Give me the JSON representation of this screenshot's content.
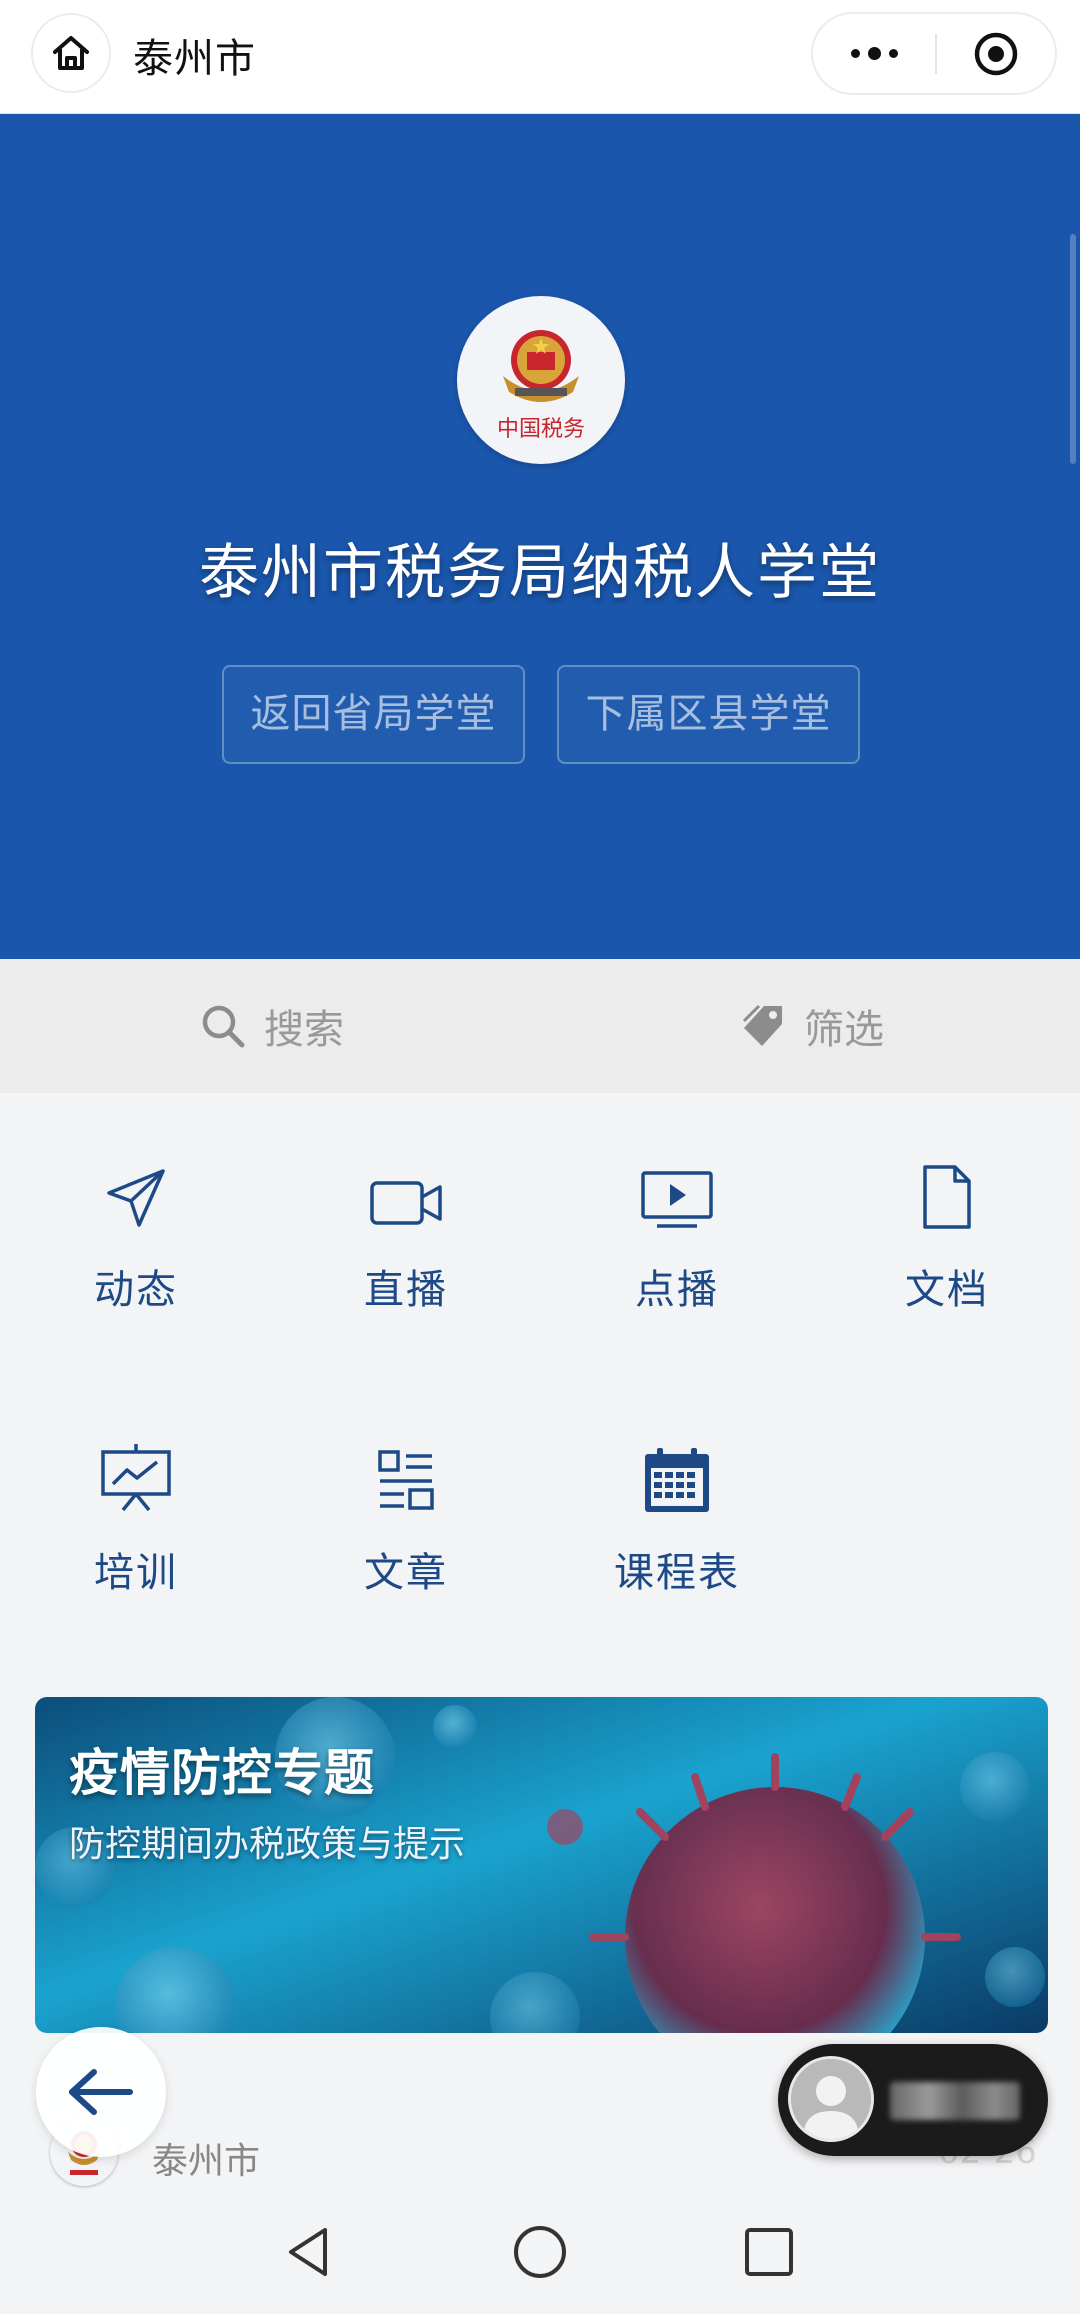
{
  "topbar": {
    "title": "泰州市",
    "home_icon": "home-icon",
    "more_icon": "more-dots-icon",
    "target_icon": "target-icon"
  },
  "banner": {
    "bg_color": "#1a56ab",
    "emblem_text": "中国税务",
    "title": "泰州市税务局纳税人学堂",
    "buttons": [
      "返回省局学堂",
      "下属区县学堂"
    ]
  },
  "toolbar": {
    "search_label": "搜索",
    "filter_label": "筛选"
  },
  "menu": {
    "items": [
      {
        "label": "动态",
        "icon": "send-icon"
      },
      {
        "label": "直播",
        "icon": "video-camera-icon"
      },
      {
        "label": "点播",
        "icon": "play-screen-icon"
      },
      {
        "label": "文档",
        "icon": "document-icon"
      },
      {
        "label": "培训",
        "icon": "presentation-icon"
      },
      {
        "label": "文章",
        "icon": "article-icon"
      },
      {
        "label": "课程表",
        "icon": "calendar-icon"
      }
    ],
    "label_color": "#1d4a86"
  },
  "promo": {
    "title": "疫情防控专题",
    "subtitle": "防控期间办税政策与提示"
  },
  "feed": {
    "name": "泰州市",
    "date": "02-26"
  }
}
